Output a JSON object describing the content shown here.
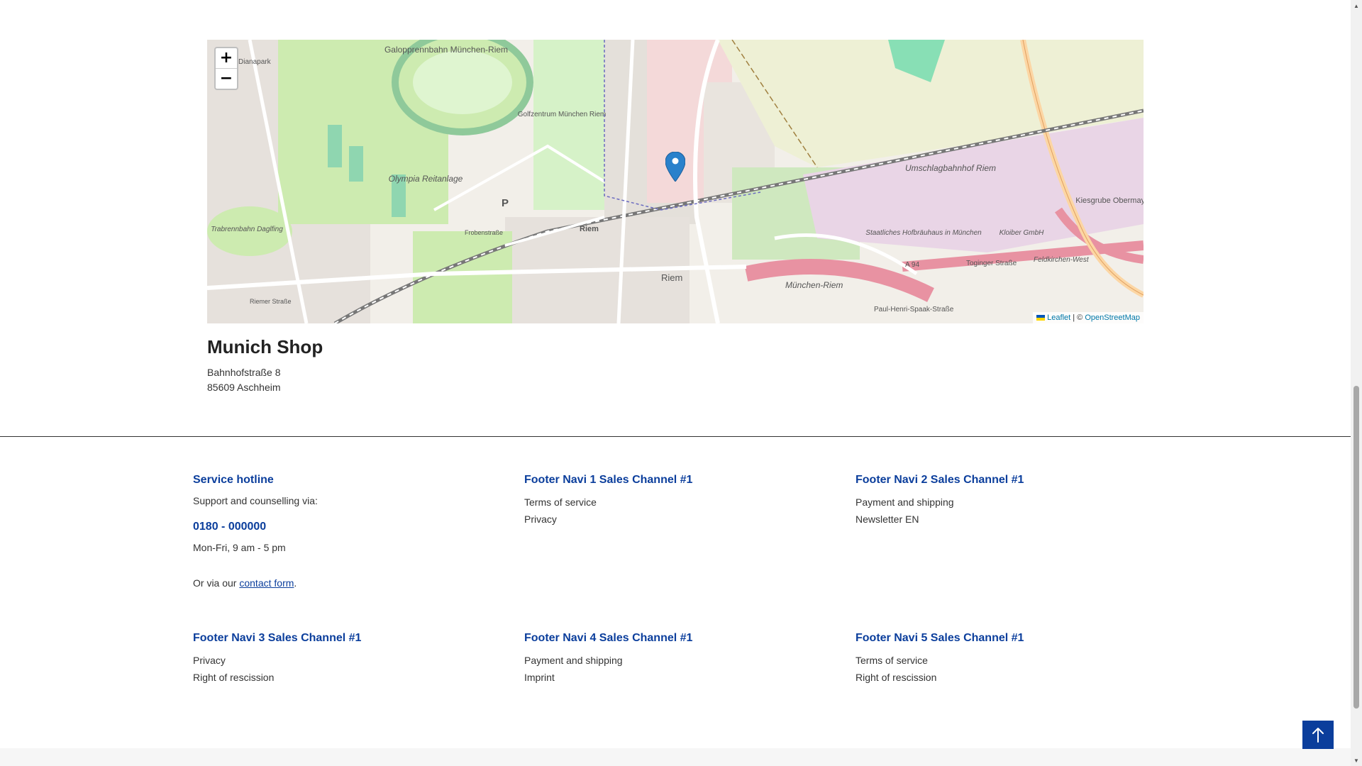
{
  "map": {
    "zoom_in": "+",
    "zoom_out": "−",
    "attribution_leaflet": "Leaflet",
    "attribution_separator": "| ©",
    "attribution_osm": "OpenStreetMap",
    "labels": {
      "galopprennbahn": "Galopprennbahn München-Riem",
      "golfzentrum": "Golfzentrum München Riem",
      "olympia": "Olympia Reitanlage",
      "trabrennbahn": "Trabrennbahn Daglfing",
      "umschlagbahnhof": "Umschlagbahnhof Riem",
      "kiesgrube": "Kiesgrube Obermayr",
      "hofbraeuhaus": "Staatliches Hofbräuhaus in München",
      "kloiber": "Kloiber GmbH",
      "riem_station": "Riem",
      "riem": "Riem",
      "muenchen_riem": "München-Riem",
      "dianapark": "Dianapark",
      "toginger": "Toginger Straße",
      "a94": "A 94",
      "feldkirchen_west": "Feldkirchen-West",
      "riemer_strasse": "Riemer Straße",
      "frobenstrasse": "Frobenstraße",
      "paul_henri": "Paul-Henri-Spaak-Straße",
      "parking": "P"
    }
  },
  "shop": {
    "title": "Munich Shop",
    "street": "Bahnhofstraße 8",
    "city": "85609 Aschheim"
  },
  "footer": {
    "service": {
      "heading": "Service hotline",
      "support": "Support and counselling via:",
      "phone": "0180 - 000000",
      "hours": "Mon-Fri, 9 am - 5 pm",
      "or_via": "Or via our",
      "contact_link": "contact form",
      "period": "."
    },
    "navi1": {
      "heading": "Footer Navi 1 Sales Channel #1",
      "links": [
        "Terms of service",
        "Privacy"
      ]
    },
    "navi2": {
      "heading": "Footer Navi 2 Sales Channel #1",
      "links": [
        "Payment and shipping",
        "Newsletter EN"
      ]
    },
    "navi3": {
      "heading": "Footer Navi 3 Sales Channel #1",
      "links": [
        "Privacy",
        "Right of rescission"
      ]
    },
    "navi4": {
      "heading": "Footer Navi 4 Sales Channel #1",
      "links": [
        "Payment and shipping",
        "Imprint"
      ]
    },
    "navi5": {
      "heading": "Footer Navi 5 Sales Channel #1",
      "links": [
        "Terms of service",
        "Right of rescission"
      ]
    }
  },
  "icons": {
    "zoom_in": "plus-icon",
    "zoom_out": "minus-icon",
    "marker": "map-marker-icon",
    "scroll_top": "arrow-up-icon"
  },
  "colors": {
    "accent": "#0b3e9c",
    "scroll_top_bg": "#0b3e9c",
    "marker": "#2a81cb"
  }
}
